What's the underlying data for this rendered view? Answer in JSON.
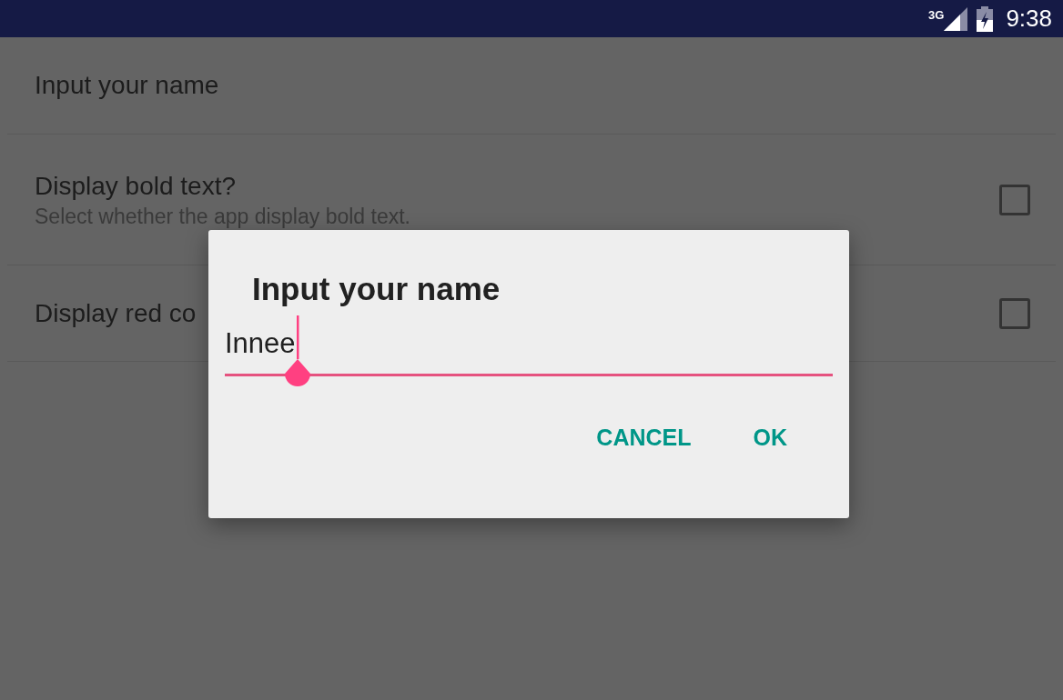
{
  "status_bar": {
    "network": "3G",
    "time": "9:38"
  },
  "preferences": [
    {
      "kind": "text",
      "title": "Input your name"
    },
    {
      "kind": "checkbox",
      "title": "Display bold text?",
      "summary": "Select whether the app display bold text.",
      "checked": false
    },
    {
      "kind": "checkbox",
      "title": "Display red co",
      "checked": false
    }
  ],
  "dialog": {
    "title": "Input your name",
    "value": "Innee",
    "buttons": [
      "CANCEL",
      "OK"
    ]
  }
}
